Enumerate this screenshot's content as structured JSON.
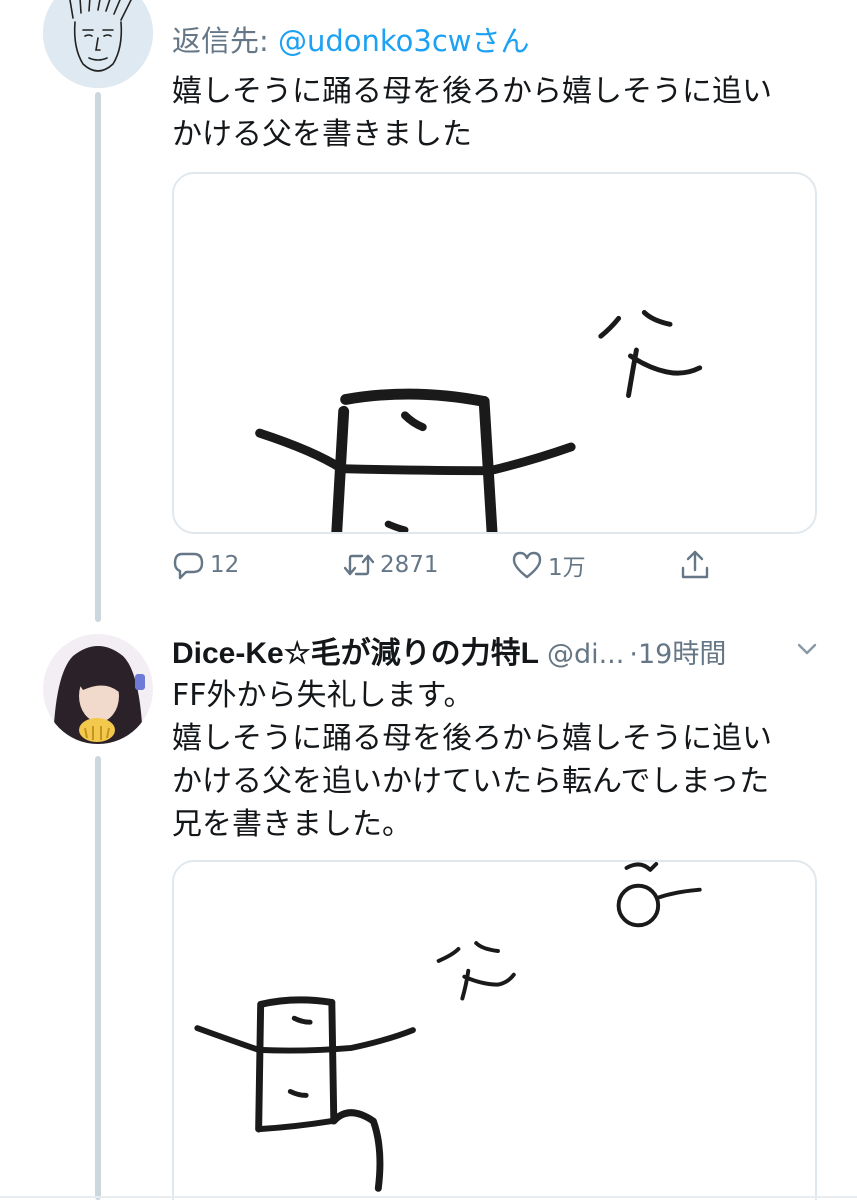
{
  "tweet1": {
    "reply_label": "返信先: ",
    "reply_handle": "@udonko3cwさん",
    "text_lines": [
      "嬉しそうに踊る母を後ろから嬉しそうに追い",
      "かける父を書きました"
    ],
    "drawing_label": "父",
    "replies": "12",
    "retweets": "2871",
    "likes": "1万"
  },
  "tweet2": {
    "display_name": "Dice-Ke☆毛が減りの力特L",
    "screen_name": "@di...",
    "time": "·19時間",
    "text_lines": [
      "FF外から失礼します。",
      "嬉しそうに踊る母を後ろから嬉しそうに追い",
      "かける父を追いかけていたら転んでしまった",
      "兄を書きました。"
    ],
    "drawing_label": "父"
  },
  "icons": {
    "reply": "speech-bubble-icon",
    "retweet": "retweet-icon",
    "like": "heart-icon",
    "share": "share-icon",
    "more": "chevron-down-icon"
  },
  "colors": {
    "link": "#1da1f2",
    "secondary_text": "#657786",
    "thread_line": "#ccd6dd",
    "border": "#e1e8ed"
  }
}
